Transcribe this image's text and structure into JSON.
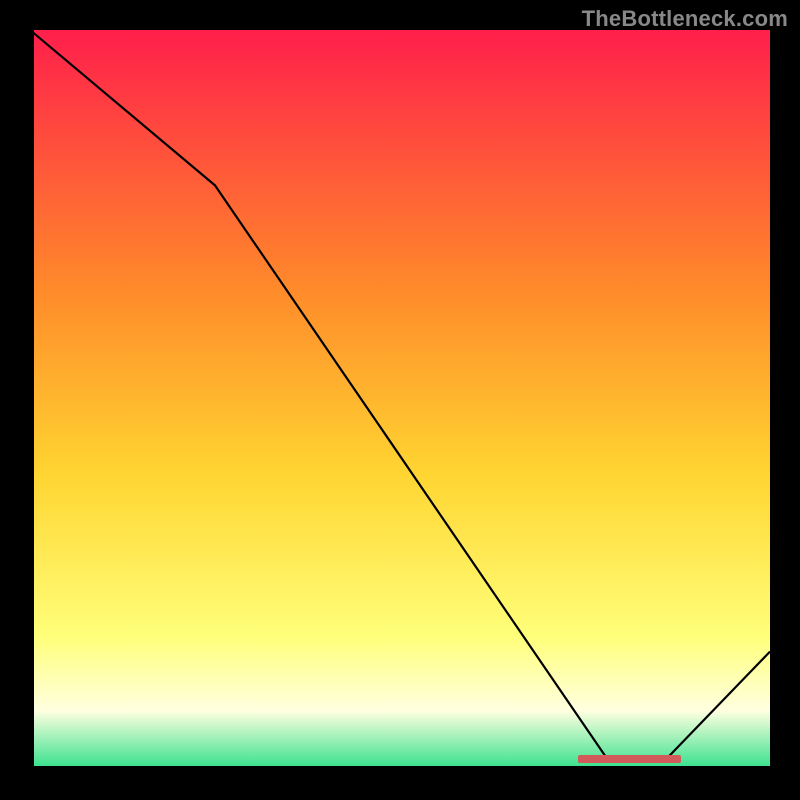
{
  "watermark": "TheBottleneck.com",
  "colors": {
    "bg": "#000000",
    "grad_top": "#ff1f4b",
    "grad_mid_upper": "#ff8a2a",
    "grad_mid": "#ffd531",
    "grad_lower": "#ffff7a",
    "grad_pale": "#ffffe0",
    "grad_green": "#2fe08a",
    "line": "#000000",
    "marker": "#d25a5a",
    "watermark_color": "#888888"
  },
  "chart_data": {
    "type": "line",
    "title": "",
    "xlabel": "",
    "ylabel": "",
    "xlim": [
      0,
      100
    ],
    "ylim": [
      0,
      100
    ],
    "series": [
      {
        "name": "curve",
        "x": [
          0,
          25,
          78,
          86,
          100
        ],
        "values": [
          100,
          79,
          1.5,
          1.5,
          16
        ]
      }
    ],
    "marker_band": {
      "x_start": 74,
      "x_end": 88,
      "y": 1.5
    },
    "gradient_stops": [
      {
        "pct": 0,
        "color_key": "grad_top"
      },
      {
        "pct": 35,
        "color_key": "grad_mid_upper"
      },
      {
        "pct": 60,
        "color_key": "grad_mid"
      },
      {
        "pct": 82,
        "color_key": "grad_lower"
      },
      {
        "pct": 92,
        "color_key": "grad_pale"
      },
      {
        "pct": 100,
        "color_key": "grad_green"
      }
    ]
  }
}
